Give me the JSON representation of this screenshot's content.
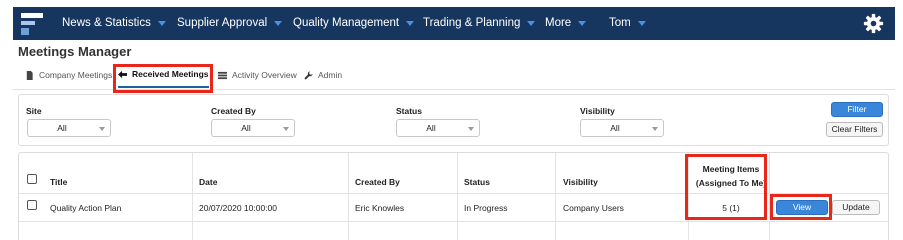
{
  "nav": {
    "items": [
      {
        "label": "News & Statistics",
        "has_menu": true
      },
      {
        "label": "Supplier Approval",
        "has_menu": true
      },
      {
        "label": "Quality Management",
        "has_menu": true
      },
      {
        "label": "Trading & Planning",
        "has_menu": true
      },
      {
        "label": "More",
        "has_menu": true
      },
      {
        "label": "Tom",
        "has_menu": true
      }
    ],
    "settings_icon": "gear-icon",
    "logo_icon": "app-logo"
  },
  "page": {
    "title": "Meetings Manager"
  },
  "tabs": [
    {
      "label": "Company Meetings",
      "icon": "document-icon",
      "active": false
    },
    {
      "label": "Received Meetings",
      "icon": "arrow-left-icon",
      "active": true
    },
    {
      "label": "Activity Overview",
      "icon": "list-icon",
      "active": false
    },
    {
      "label": "Admin",
      "icon": "wrench-icon",
      "active": false
    }
  ],
  "filters": {
    "fields": [
      {
        "label": "Site",
        "value": "All"
      },
      {
        "label": "Created By",
        "value": "All"
      },
      {
        "label": "Status",
        "value": "All"
      },
      {
        "label": "Visibility",
        "value": "All"
      }
    ],
    "filter_button": "Filter",
    "clear_button": "Clear Filters"
  },
  "table": {
    "headers": {
      "title": "Title",
      "date": "Date",
      "created_by": "Created By",
      "status": "Status",
      "visibility": "Visibility",
      "items_line1": "Meeting Items",
      "items_line2": "(Assigned To Me)"
    },
    "rows": [
      {
        "title": "Quality Action Plan",
        "date": "20/07/2020 10:00:00",
        "created_by": "Eric Knowles",
        "status": "In Progress",
        "visibility": "Company Users",
        "items": "5 (1)",
        "view_label": "View",
        "update_label": "Update"
      }
    ]
  },
  "colors": {
    "nav_bg": "#16365f",
    "accent": "#3a86d9",
    "highlight": "#e8261a"
  }
}
